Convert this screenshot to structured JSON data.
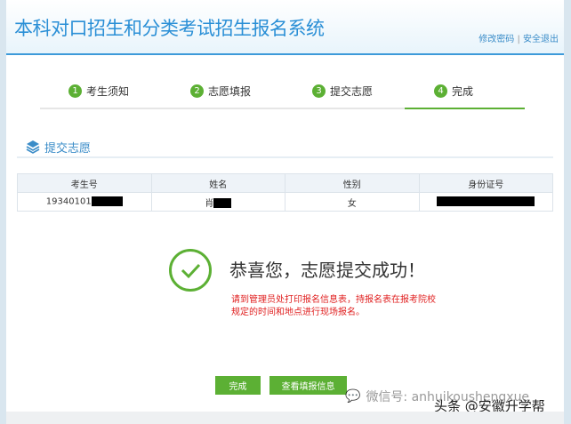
{
  "header": {
    "title": "本科对口招生和分类考试招生报名系统",
    "change_password": "修改密码",
    "separator": "|",
    "logout": "安全退出"
  },
  "steps": [
    {
      "num": "1",
      "label": "考生须知"
    },
    {
      "num": "2",
      "label": "志愿填报"
    },
    {
      "num": "3",
      "label": "提交志愿"
    },
    {
      "num": "4",
      "label": "完成"
    }
  ],
  "section": {
    "title": "提交志愿"
  },
  "table": {
    "headers": [
      "考生号",
      "姓名",
      "性别",
      "身份证号"
    ],
    "row": {
      "exam_no": "19340101",
      "name": "肖",
      "gender": "女"
    }
  },
  "success": {
    "message": "恭喜您，志愿提交成功！",
    "note": "请到管理员处打印报名信息表，持报名表在报考院校规定的时间和地点进行现场报名。"
  },
  "buttons": {
    "done": "完成",
    "view": "查看填报信息"
  },
  "watermark": {
    "wechat": "微信号: anhuikoushengxue",
    "toutiao": "头条 @安徽升学帮"
  },
  "colors": {
    "accent": "#2a8fd6",
    "green": "#5cb034",
    "red": "#e02020"
  }
}
